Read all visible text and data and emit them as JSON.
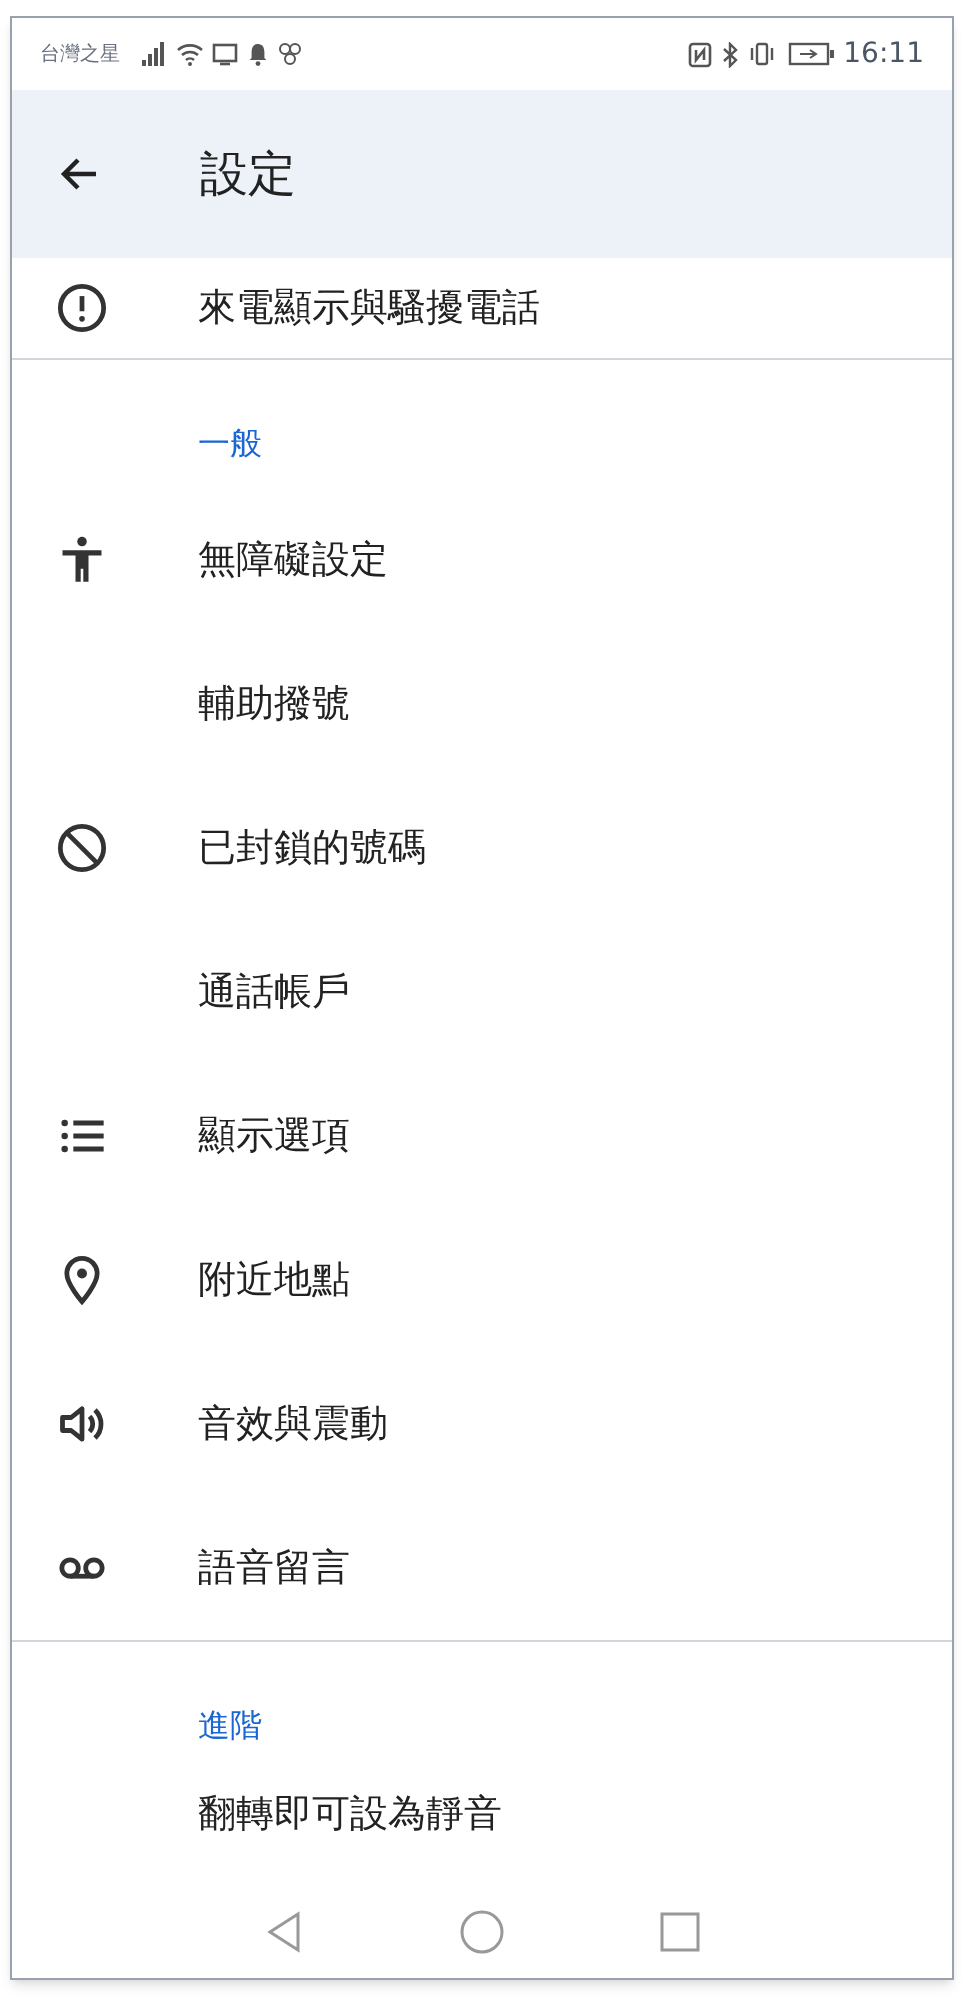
{
  "status_bar": {
    "carrier": "台灣之星",
    "time": "16:11"
  },
  "app_bar": {
    "title": "設定"
  },
  "sections": [
    {
      "items": [
        {
          "label": "來電顯示與騷擾電話",
          "kind": "alert"
        }
      ]
    },
    {
      "header": "一般",
      "items": [
        {
          "label": "無障礙設定",
          "kind": "accessibility"
        },
        {
          "label": "輔助撥號",
          "kind": "none"
        },
        {
          "label": "已封鎖的號碼",
          "kind": "block"
        },
        {
          "label": "通話帳戶",
          "kind": "none"
        },
        {
          "label": "顯示選項",
          "kind": "list"
        },
        {
          "label": "附近地點",
          "kind": "pin"
        },
        {
          "label": "音效與震動",
          "kind": "volume"
        },
        {
          "label": "語音留言",
          "kind": "voicemail"
        }
      ]
    },
    {
      "header": "進階",
      "items": [
        {
          "label": "翻轉即可設為靜音",
          "kind": "none"
        }
      ]
    }
  ]
}
